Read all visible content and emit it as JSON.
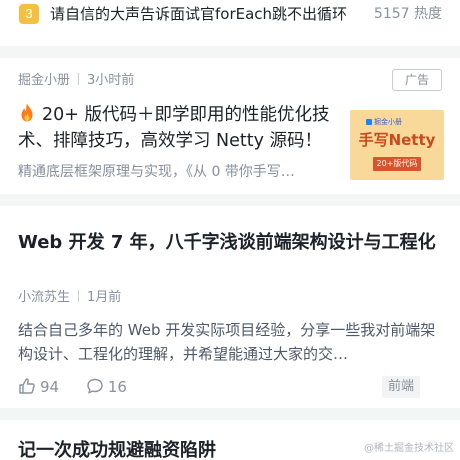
{
  "hot_item": {
    "rank": "3",
    "title": "请自信的大声告诉面试官forEach跳不出循环",
    "heat": "5157 热度"
  },
  "ad": {
    "source": "掘金小册",
    "time": "3小时前",
    "badge": "广告",
    "title": "20+ 版代码＋即学即用的性能优化技术、排障技巧，高效学习 Netty 源码！",
    "description": "精通底层框架原理与实现，《从 0 带你手写…",
    "thumbnail": {
      "logo_text": "掘金小册",
      "title": "手写Netty",
      "tag": "20+版代码"
    }
  },
  "article": {
    "title": "Web 开发 7 年，八千字浅谈前端架构设计与工程化",
    "author": "小流苏生",
    "time": "1月前",
    "abstract": "结合自己多年的 Web 开发实际项目经验，分享一些我对前端架构设计、工程化的理解，并希望能通过大家的交…",
    "likes": "94",
    "comments": "16",
    "tag": "前端"
  },
  "next_article": {
    "title": "记一次成功规避融资陷阱"
  },
  "watermark": "@稀土掘金技术社区",
  "colors": {
    "rank_badge": "#f5c040",
    "fire": "#ff7a1a",
    "thumb_bg": "#f8d99a",
    "thumb_title": "#c84a1e",
    "thumb_tag": "#d9532b"
  }
}
